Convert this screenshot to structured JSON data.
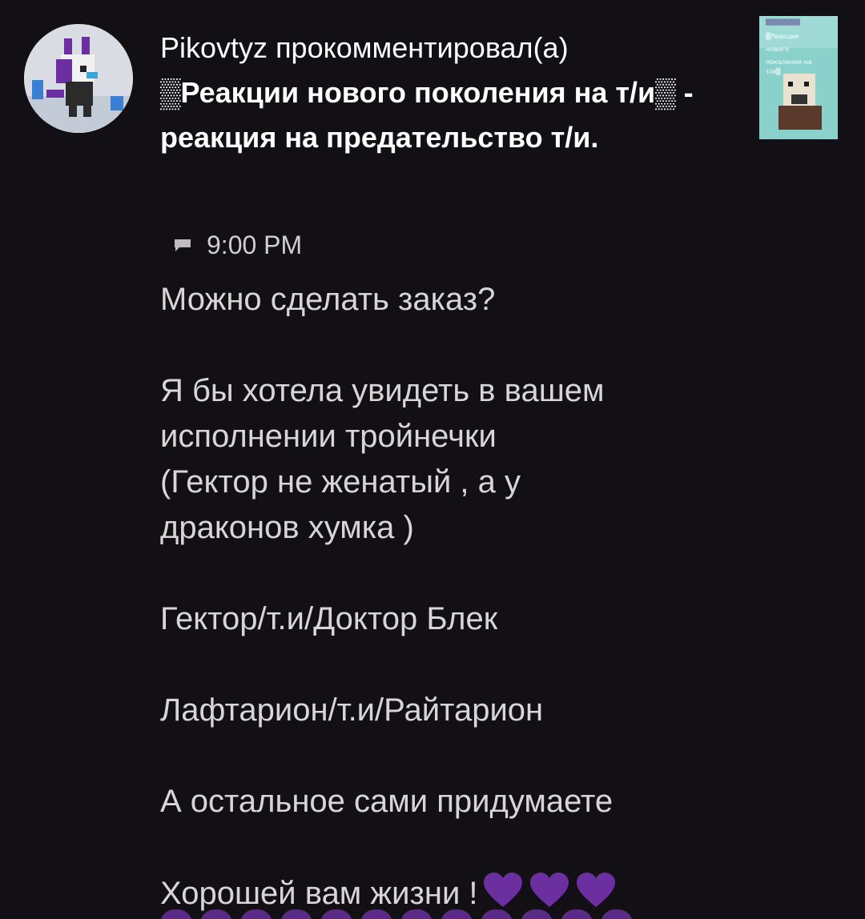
{
  "notification": {
    "username": "Pikovtyz",
    "action": "прокомментировал(а)",
    "post_title": "▒Реакции нового поколения на т/и▒ - реакция на предательство т/и.",
    "time": "9:00 PM",
    "thumbnail_text": [
      "▒Реакции",
      "нового",
      "поколения на",
      "т/и▒"
    ]
  },
  "comment": {
    "lines": [
      "Можно сделать заказ?",
      "",
      "Я бы хотела увидеть в вашем",
      "исполнении тройнечки",
      "(Гектор не женатый , а у",
      "драконов хумка )",
      "",
      "Гектор/т.и/Доктор Блек",
      "",
      "Лафтарион/т.и/Райтарион",
      "",
      "А остальное сами придумаете",
      "",
      "Хорошей вам жизни !"
    ],
    "trailing_emoji": "purple-heart"
  },
  "colors": {
    "background": "#121014",
    "title_text": "#ffffff",
    "body_text": "#d6d6d6",
    "heart": "#6b2fa0"
  }
}
